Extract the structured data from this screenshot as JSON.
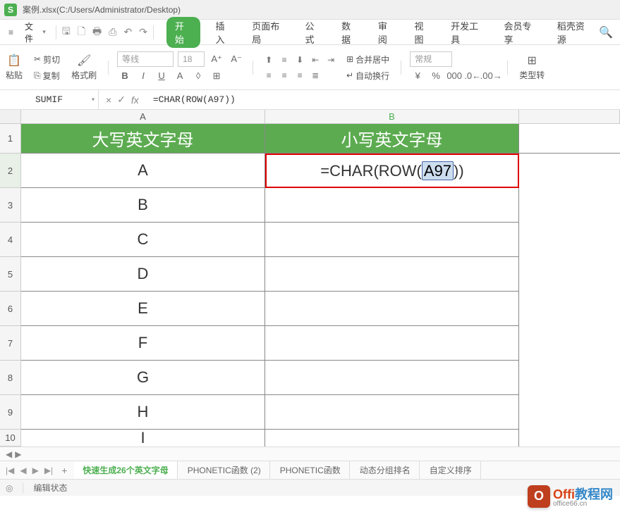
{
  "app": {
    "icon_letter": "S",
    "title": "案例.xlsx(C:/Users/Administrator/Desktop)"
  },
  "menu": {
    "hamburger": "≡",
    "file_label": "文件",
    "tabs": [
      "开始",
      "插入",
      "页面布局",
      "公式",
      "数据",
      "审阅",
      "视图",
      "开发工具",
      "会员专享",
      "稻壳资源"
    ],
    "active_tab_index": 0
  },
  "ribbon": {
    "paste_label": "粘贴",
    "cut_label": "剪切",
    "copy_label": "复制",
    "format_painter_label": "格式刷",
    "font_name": "等线",
    "font_size": "18",
    "bold": "B",
    "italic": "I",
    "underline": "U",
    "strike": "A",
    "merge_label": "合并居中",
    "wrap_label": "自动换行",
    "number_format": "常规",
    "type_convert": "类型转"
  },
  "formula_bar": {
    "name_box": "SUMIF",
    "cancel": "×",
    "enter": "✓",
    "fx": "fx",
    "formula": "=CHAR(ROW(A97))"
  },
  "columns": [
    "A",
    "B"
  ],
  "headers": {
    "col_a": "大写英文字母",
    "col_b": "小写英文字母"
  },
  "rows": [
    {
      "n": 1
    },
    {
      "n": 2,
      "a": "A",
      "b_formula": {
        "pre": "=CHAR(ROW(",
        "ref": "A97",
        "post": "))"
      }
    },
    {
      "n": 3,
      "a": "B"
    },
    {
      "n": 4,
      "a": "C"
    },
    {
      "n": 5,
      "a": "D"
    },
    {
      "n": 6,
      "a": "E"
    },
    {
      "n": 7,
      "a": "F"
    },
    {
      "n": 8,
      "a": "G"
    },
    {
      "n": 9,
      "a": "H"
    },
    {
      "n": 10,
      "a": "I"
    }
  ],
  "sheet_tabs": [
    "快速生成26个英文字母",
    "PHONETIC函数 (2)",
    "PHONETIC函数",
    "动态分组排名",
    "自定义排序"
  ],
  "active_sheet_index": 0,
  "status": {
    "mode": "编辑状态"
  },
  "watermark": {
    "logo": "O",
    "text1": "Offi",
    "text2": "教程网",
    "sub": "office66.cn"
  }
}
